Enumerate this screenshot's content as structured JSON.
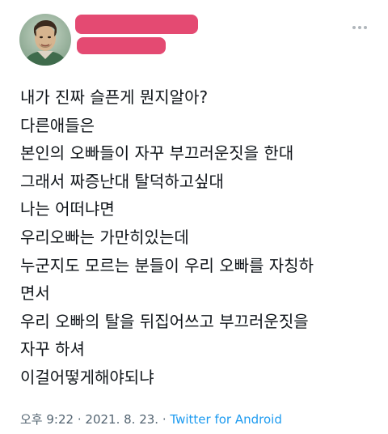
{
  "author": {
    "avatar": "user-avatar",
    "name_redaction_color": "#e44a72"
  },
  "tweet": {
    "lines": [
      "내가 진짜 슬픈게 뭔지알아?",
      "다른애들은",
      "본인의 오빠들이 자꾸 부끄러운짓을 한대",
      "그래서 짜증난대 탈덕하고싶대",
      "나는 어떠냐면",
      "우리오빠는 가만히있는데",
      "누군지도 모르는 분들이 우리 오빠를 자칭하",
      "면서",
      "우리 오빠의 탈을 뒤집어쓰고 부끄러운짓을",
      "자꾸 하셔",
      "이걸어떻게해야되냐"
    ],
    "time": "오후 9:22",
    "separator": "·",
    "date": "2021. 8. 23.",
    "source": "Twitter for Android"
  },
  "icons": {
    "more": "more-options-icon"
  },
  "colors": {
    "text": "#0f1419",
    "muted": "#536471",
    "link": "#1d9bf0"
  }
}
